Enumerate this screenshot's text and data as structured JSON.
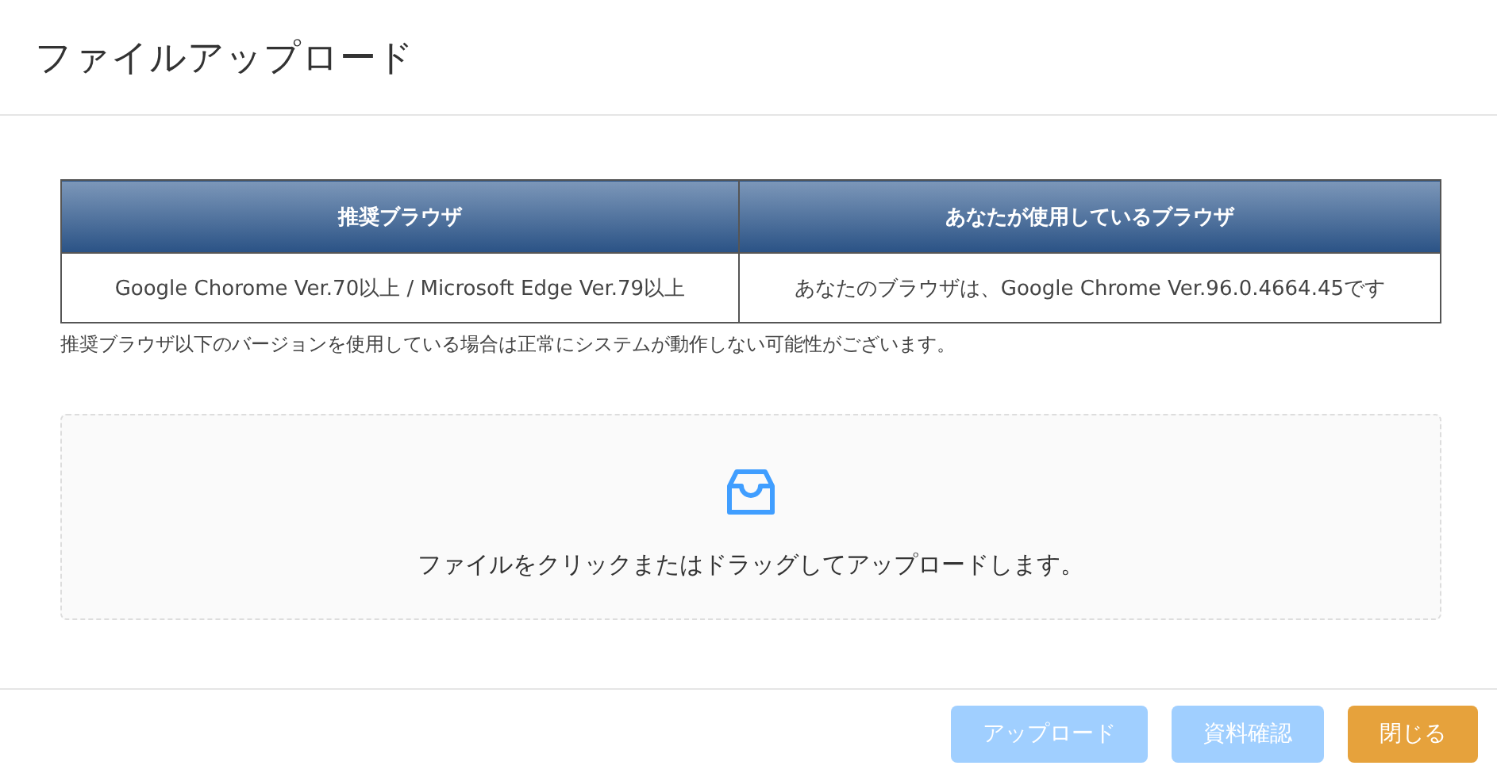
{
  "dialog": {
    "title": "ファイルアップロード"
  },
  "browser_table": {
    "columns": [
      "推奨ブラウザ",
      "あなたが使用しているブラウザ"
    ],
    "rows": [
      [
        "Google Chorome Ver.70以上 / Microsoft Edge Ver.79以上",
        "あなたのブラウザは、Google Chrome Ver.96.0.4664.45です"
      ]
    ]
  },
  "note": "推奨ブラウザ以下のバージョンを使用している場合は正常にシステムが動作しない可能性がございます。",
  "dropzone": {
    "text": "ファイルをクリックまたはドラッグしてアップロードします。"
  },
  "buttons": [
    {
      "label": "アップロード",
      "kind": "primary",
      "disabled": true
    },
    {
      "label": "資料確認",
      "kind": "primary",
      "disabled": true
    },
    {
      "label": "閉じる",
      "kind": "warning",
      "disabled": false
    }
  ]
}
